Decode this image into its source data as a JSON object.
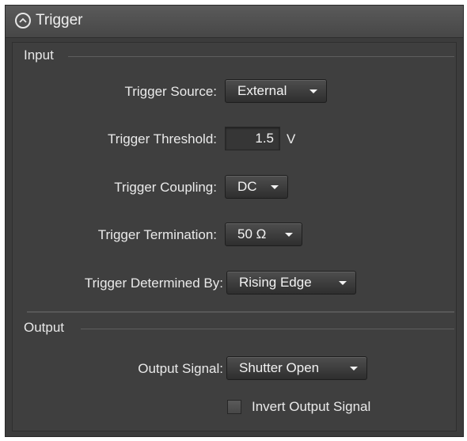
{
  "panel": {
    "title": "Trigger",
    "collapse_icon": "chevron-up-circle-icon"
  },
  "input_section": {
    "title": "Input",
    "rows": [
      {
        "label": "Trigger Source:",
        "value": "External"
      },
      {
        "label": "Trigger Threshold:",
        "value": "1.5",
        "unit": "V"
      },
      {
        "label": "Trigger Coupling:",
        "value": "DC"
      },
      {
        "label": "Trigger Termination:",
        "value": "50 Ω"
      },
      {
        "label": "Trigger Determined By:",
        "value": "Rising Edge"
      }
    ]
  },
  "output_section": {
    "title": "Output",
    "output_signal": {
      "label": "Output Signal:",
      "value": "Shutter Open"
    },
    "invert": {
      "label": "Invert Output Signal",
      "checked": false
    }
  },
  "colors": {
    "panel_bg": "#3c3c3c",
    "header_bg": "#505050",
    "text": "#eaeaea"
  }
}
